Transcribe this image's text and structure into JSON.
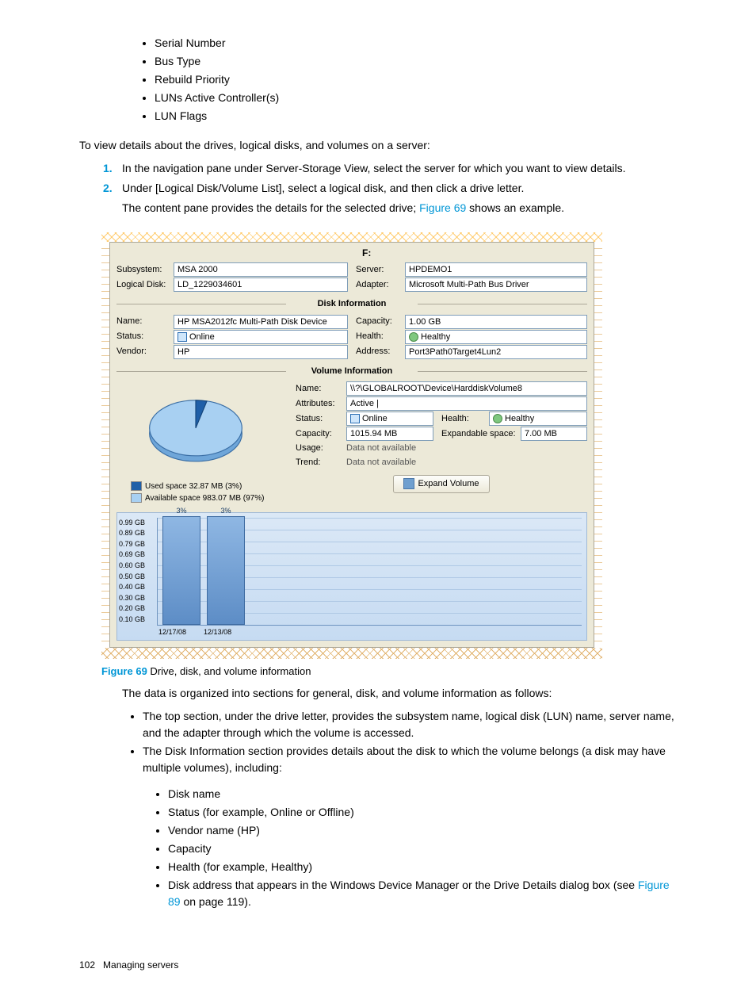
{
  "props_list": [
    "Serial Number",
    "Bus Type",
    "Rebuild Priority",
    "LUNs Active Controller(s)",
    "LUN Flags"
  ],
  "intro": "To view details about the drives, logical disks, and volumes on a server:",
  "steps": [
    "In the navigation pane under Server-Storage View, select the server for which you want to view details.",
    "Under [Logical Disk/Volume List], select a logical disk, and then click a drive letter."
  ],
  "step2_line2_a": "The content pane provides the details for the selected drive; ",
  "step2_line2_link": "Figure 69",
  "step2_line2_b": " shows an example.",
  "screenshot": {
    "drive_letter": "F:",
    "top": {
      "subsystem_lbl": "Subsystem:",
      "subsystem": "MSA 2000",
      "server_lbl": "Server:",
      "server": "HPDEMO1",
      "logical_disk_lbl": "Logical Disk:",
      "logical_disk": "LD_1229034601",
      "adapter_lbl": "Adapter:",
      "adapter": "Microsoft Multi-Path Bus Driver"
    },
    "disk_section": "Disk Information",
    "disk": {
      "name_lbl": "Name:",
      "name": "HP MSA2012fc  Multi-Path Disk Device",
      "capacity_lbl": "Capacity:",
      "capacity": "1.00 GB",
      "status_lbl": "Status:",
      "status": "Online",
      "health_lbl": "Health:",
      "health": "Healthy",
      "vendor_lbl": "Vendor:",
      "vendor": "HP",
      "address_lbl": "Address:",
      "address": "Port3Path0Target4Lun2"
    },
    "vol_section": "Volume Information",
    "vol": {
      "name_lbl": "Name:",
      "name": "\\\\?\\GLOBALROOT\\Device\\HarddiskVolume8",
      "attr_lbl": "Attributes:",
      "attr": "Active |",
      "status_lbl": "Status:",
      "status": "Online",
      "health_lbl": "Health:",
      "health": "Healthy",
      "capacity_lbl": "Capacity:",
      "capacity": "1015.94 MB",
      "exp_lbl": "Expandable space:",
      "exp": "7.00 MB",
      "usage_lbl": "Usage:",
      "usage": "Data not available",
      "trend_lbl": "Trend:",
      "trend": "Data not available"
    },
    "legend_used": "Used space 32.87 MB (3%)",
    "legend_avail": "Available space 983.07 MB (97%)",
    "expand_btn": "Expand Volume",
    "chart_data": {
      "type": "bar",
      "categories": [
        "12/17/08",
        "12/13/08"
      ],
      "values": [
        0.99,
        0.99
      ],
      "percent_labels": [
        "3%",
        "3%"
      ],
      "ylabel": "",
      "xlabel": "",
      "yticks": [
        "0.99 GB",
        "0.89 GB",
        "0.79 GB",
        "0.69 GB",
        "0.60 GB",
        "0.50 GB",
        "0.40 GB",
        "0.30 GB",
        "0.20 GB",
        "0.10 GB"
      ],
      "ylim": [
        0,
        0.99
      ]
    },
    "pie_data": {
      "type": "pie",
      "slices": [
        {
          "name": "Used",
          "percent": 3,
          "color": "#1f5fa8"
        },
        {
          "name": "Available",
          "percent": 97,
          "color": "#8fc2ef"
        }
      ]
    }
  },
  "fig_caption_num": "Figure 69",
  "fig_caption_txt": " Drive, disk, and volume information",
  "after1": "The data is organized into sections for general, disk, and volume information as follows:",
  "bullets1": [
    "The top section, under the drive letter, provides the subsystem name, logical disk (LUN) name, server name, and the adapter through which the volume is accessed.",
    "The Disk Information section provides details about the disk to which the volume belongs (a disk may have multiple volumes), including:"
  ],
  "bullets2": [
    "Disk name",
    "Status (for example, Online or Offline)",
    "Vendor name (HP)",
    "Capacity",
    "Health (for example, Healthy)"
  ],
  "bullet2_last_a": "Disk address that appears in the Windows Device Manager or the Drive Details dialog box (see ",
  "bullet2_last_link": "Figure 89",
  "bullet2_last_b": " on page 119).",
  "footer_page": "102",
  "footer_text": "Managing servers"
}
